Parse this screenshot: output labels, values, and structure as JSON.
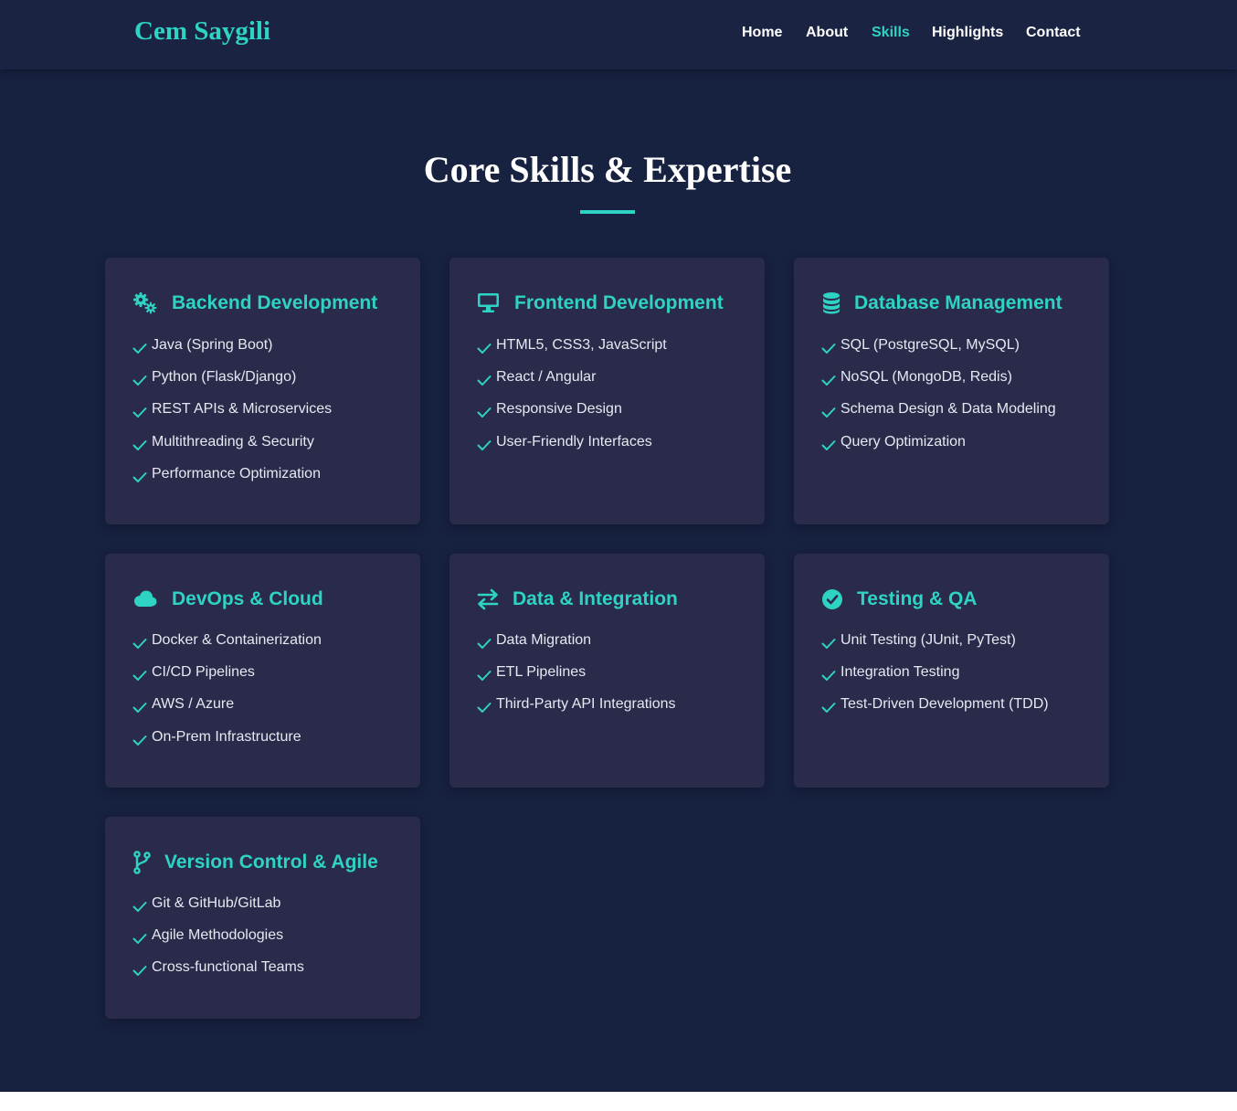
{
  "header": {
    "brand": "Cem Saygili",
    "nav": [
      {
        "label": "Home",
        "active": false
      },
      {
        "label": "About",
        "active": false
      },
      {
        "label": "Skills",
        "active": true
      },
      {
        "label": "Highlights",
        "active": false
      },
      {
        "label": "Contact",
        "active": false
      }
    ]
  },
  "section": {
    "title": "Core Skills & Expertise"
  },
  "colors": {
    "accent": "#2ed3c3",
    "background": "#172140",
    "card": "#2a2b4a",
    "text": "#e6e8f2"
  },
  "cards": [
    {
      "icon": "gears-icon",
      "title": "Backend Development",
      "items": [
        "Java (Spring Boot)",
        "Python (Flask/Django)",
        "REST APIs & Microservices",
        "Multithreading & Security",
        "Performance Optimization"
      ]
    },
    {
      "icon": "desktop-icon",
      "title": "Frontend Development",
      "items": [
        "HTML5, CSS3, JavaScript",
        "React / Angular",
        "Responsive Design",
        "User-Friendly Interfaces"
      ]
    },
    {
      "icon": "database-icon",
      "title": "Database Management",
      "items": [
        "SQL (PostgreSQL, MySQL)",
        "NoSQL (MongoDB, Redis)",
        "Schema Design & Data Modeling",
        "Query Optimization"
      ]
    },
    {
      "icon": "cloud-icon",
      "title": "DevOps & Cloud",
      "items": [
        "Docker & Containerization",
        "CI/CD Pipelines",
        "AWS / Azure",
        "On-Prem Infrastructure"
      ]
    },
    {
      "icon": "exchange-icon",
      "title": "Data & Integration",
      "items": [
        "Data Migration",
        "ETL Pipelines",
        "Third-Party API Integrations"
      ]
    },
    {
      "icon": "check-circle-icon",
      "title": "Testing & QA",
      "items": [
        "Unit Testing (JUnit, PyTest)",
        "Integration Testing",
        "Test-Driven Development (TDD)"
      ]
    },
    {
      "icon": "code-branch-icon",
      "title": "Version Control & Agile",
      "items": [
        "Git & GitHub/GitLab",
        "Agile Methodologies",
        "Cross-functional Teams"
      ]
    }
  ]
}
